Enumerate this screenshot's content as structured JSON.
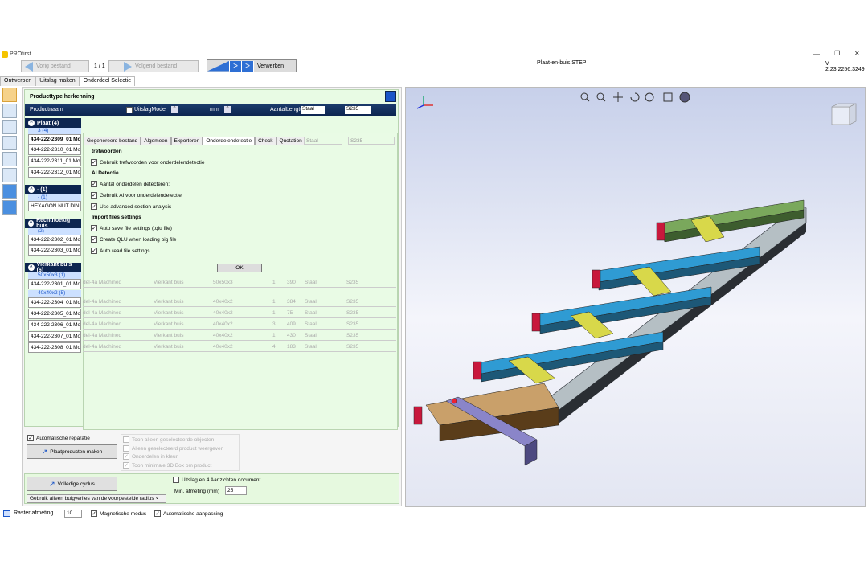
{
  "app": {
    "title": "PROfirst",
    "file_name": "Plaat-en-buis.STEP",
    "version": "V 2.23.2256.3249"
  },
  "toolbar": {
    "prev_label": "Vorig bestand",
    "page_indicator": "1 / 1",
    "next_label": "Volgend bestand",
    "process_label": "Verwerken"
  },
  "main_tabs": [
    "Ontwerpen",
    "Uitslag maken",
    "Onderdeel Selectie"
  ],
  "producttype": {
    "title": "Producttype herkenning",
    "columns": {
      "name": "Productnaam",
      "unfold": "UitslagModel",
      "unit": "mm",
      "length": "AantalLengte",
      "material": "Staal",
      "grade": "S235"
    },
    "groups": [
      {
        "label": "Plaat  (4)",
        "sub": "3  (4)",
        "rows": [
          "434-222-2309_01 Mo",
          "434-222-2310_01 Mo",
          "434-222-2311_01 Mo",
          "434-222-2312_01 Mo"
        ]
      },
      {
        "label": "-  (1)",
        "sub": "-  (1)",
        "rows": [
          "HEXAGON NUT DIN 9"
        ]
      },
      {
        "label": "Rechthoekig buis",
        "sub": "(2)",
        "rows": [
          "434-222-2302_01 Mo",
          "434-222-2303_01 Mo"
        ]
      },
      {
        "label": "Vierkant buis  (6)",
        "sub": "50x50x3  (1)",
        "rows": [
          "434-222-2301_01 Mo"
        ],
        "sub2": "40x40x2  (5)",
        "rows2": [
          "434-222-2304_01 Mo",
          "434-222-2305_01 Mo",
          "434-222-2306_01 Mo",
          "434-222-2307_01 Mo",
          "434-222-2308_01 Mo"
        ]
      }
    ],
    "ghost_rows": [
      {
        "model": "del-4a Machined",
        "type": "Vierkant buis",
        "size": "50x50x3",
        "qty": "1",
        "len": "390",
        "mat": "Staal",
        "grade": "S235"
      },
      {
        "model": "del-4a Machined",
        "type": "Vierkant buis",
        "size": "40x40x2",
        "qty": "1",
        "len": "384",
        "mat": "Staal",
        "grade": "S235"
      },
      {
        "model": "del-4a Machined",
        "type": "Vierkant buis",
        "size": "40x40x2",
        "qty": "1",
        "len": "75",
        "mat": "Staal",
        "grade": "S235"
      },
      {
        "model": "del-4a Machined",
        "type": "Vierkant buis",
        "size": "40x40x2",
        "qty": "3",
        "len": "409",
        "mat": "Staal",
        "grade": "S235"
      },
      {
        "model": "del-4a Machined",
        "type": "Vierkant buis",
        "size": "40x40x2",
        "qty": "1",
        "len": "430",
        "mat": "Staal",
        "grade": "S235"
      },
      {
        "model": "del-4a Machined",
        "type": "Vierkant buis",
        "size": "40x40x2",
        "qty": "4",
        "len": "183",
        "mat": "Staal",
        "grade": "S235"
      }
    ]
  },
  "dialog": {
    "tabs": [
      "Gegenereerd bestand",
      "Algemeen",
      "Exporteren",
      "Onderdelendetectie",
      "Check",
      "Quotation"
    ],
    "ghost_material": "Staal",
    "ghost_grade": "S235",
    "sections": [
      {
        "title": "trefwoorden",
        "items": [
          "Gebruik trefwoorden voor onderdelendetectie"
        ]
      },
      {
        "title": "AI Detectie",
        "items": [
          "Aantal onderdelen detecteren:",
          "Gebruik AI voor onderdelendetectie",
          "Use advanced section analysis"
        ]
      },
      {
        "title": "Import files settings",
        "items": [
          "Auto save file settings (.qlu file)",
          "Create QLU when loading big file",
          "Auto read file settings"
        ]
      }
    ],
    "ok_label": "OK"
  },
  "bottom": {
    "auto_repair": "Automatische reparatie",
    "plate_products": "Plaatproducten maken",
    "view_options": [
      "Toon alleen geselecteerde objecten",
      "Alleen geselecteerd product weergeven",
      "Onderdelen in kleur",
      "Toon minimale 3D Box om product"
    ],
    "full_cycle": "Volledige cyclus",
    "unfold_4_views": "Uitslag en 4 Aanzichten document",
    "min_dim_label": "Min. afmeting (mm)",
    "min_dim_value": "25",
    "bend_option": "Gebruik alleen buigverlies van de voorgestelde radius"
  },
  "status": {
    "grid": "Raster afmeting",
    "grid_value": "10",
    "magnetic": "Magnetische modus",
    "auto_adjust": "Automatische aanpassing"
  },
  "colors": {
    "accent": "#2e6fd4",
    "header_dark": "#0d2550",
    "panel_green": "#e8fbe4"
  }
}
